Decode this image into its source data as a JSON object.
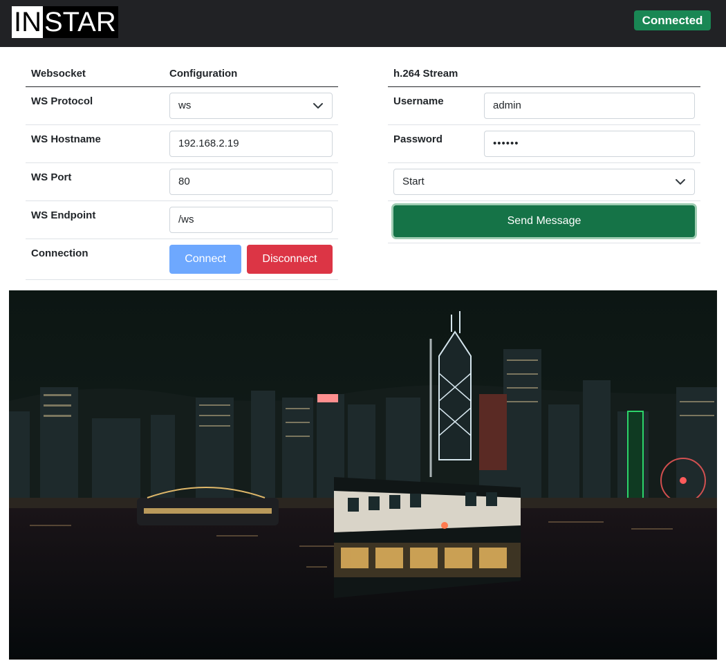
{
  "header": {
    "logo_in": "IN",
    "logo_star": "STAR",
    "status": "Connected"
  },
  "ws_config": {
    "col_websocket": "Websocket",
    "col_configuration": "Configuration",
    "rows": {
      "protocol": {
        "label": "WS Protocol",
        "value": "ws"
      },
      "hostname": {
        "label": "WS Hostname",
        "value": "192.168.2.19"
      },
      "port": {
        "label": "WS Port",
        "value": "80"
      },
      "endpoint": {
        "label": "WS Endpoint",
        "value": "/ws"
      },
      "connection": {
        "label": "Connection",
        "connect_label": "Connect",
        "disconnect_label": "Disconnect"
      }
    }
  },
  "stream": {
    "title": "h.264 Stream",
    "username": {
      "label": "Username",
      "value": "admin"
    },
    "password": {
      "label": "Password",
      "value": "••••••"
    },
    "action_select": {
      "value": "Start"
    },
    "send_label": "Send Message"
  },
  "video": {
    "icon": "live-stream-frame-harbour-night"
  },
  "colors": {
    "navbar": "#212225",
    "success": "#198754",
    "primary_light": "#6ea8fe",
    "danger": "#dc3545",
    "send": "#157347"
  }
}
